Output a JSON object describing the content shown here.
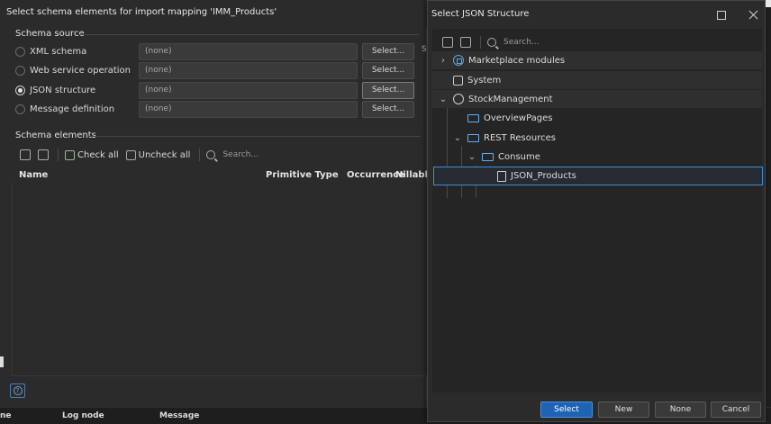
{
  "import_dialog": {
    "title": "Select schema elements for import mapping 'IMM_Products'",
    "schema_source_label": "Schema source",
    "options": [
      {
        "label": "XML schema",
        "value": "(none)",
        "button": "Select...",
        "selected": false
      },
      {
        "label": "Web service operation",
        "value": "(none)",
        "button": "Select...",
        "selected": false
      },
      {
        "label": "JSON structure",
        "value": "(none)",
        "button": "Select...",
        "selected": true
      },
      {
        "label": "Message definition",
        "value": "(none)",
        "button": "Select...",
        "selected": false
      }
    ],
    "truncated_label": "S",
    "schema_elements_label": "Schema elements",
    "check_all": "Check all",
    "uncheck_all": "Uncheck all",
    "search_placeholder": "Search...",
    "columns": {
      "name": "Name",
      "primitive_type": "Primitive Type",
      "occurrence": "Occurrence",
      "nillable": "Nillable"
    }
  },
  "bottom_panel": {
    "col1": "ne",
    "col2": "Log node",
    "col3": "Message"
  },
  "json_dialog": {
    "title": "Select JSON Structure",
    "search_placeholder": "Search...",
    "tree": [
      {
        "label": "Marketplace modules",
        "icon": "module-icon",
        "chevron": "right"
      },
      {
        "label": "System",
        "icon": "system-icon",
        "chevron": ""
      },
      {
        "label": "StockManagement",
        "icon": "app-icon",
        "chevron": "down"
      },
      {
        "label": "OverviewPages",
        "icon": "folder-icon",
        "chevron": ""
      },
      {
        "label": "REST Resources",
        "icon": "folder-icon",
        "chevron": "down"
      },
      {
        "label": "Consume",
        "icon": "folder-icon",
        "chevron": "down"
      },
      {
        "label": "JSON_Products",
        "icon": "json-structure-icon",
        "chevron": ""
      }
    ],
    "buttons": {
      "select": "Select",
      "new": "New",
      "none": "None",
      "cancel": "Cancel"
    }
  },
  "colors": {
    "accent": "#1e63b4",
    "selection_border": "#3d8fdb",
    "folder": "#62aef0"
  }
}
